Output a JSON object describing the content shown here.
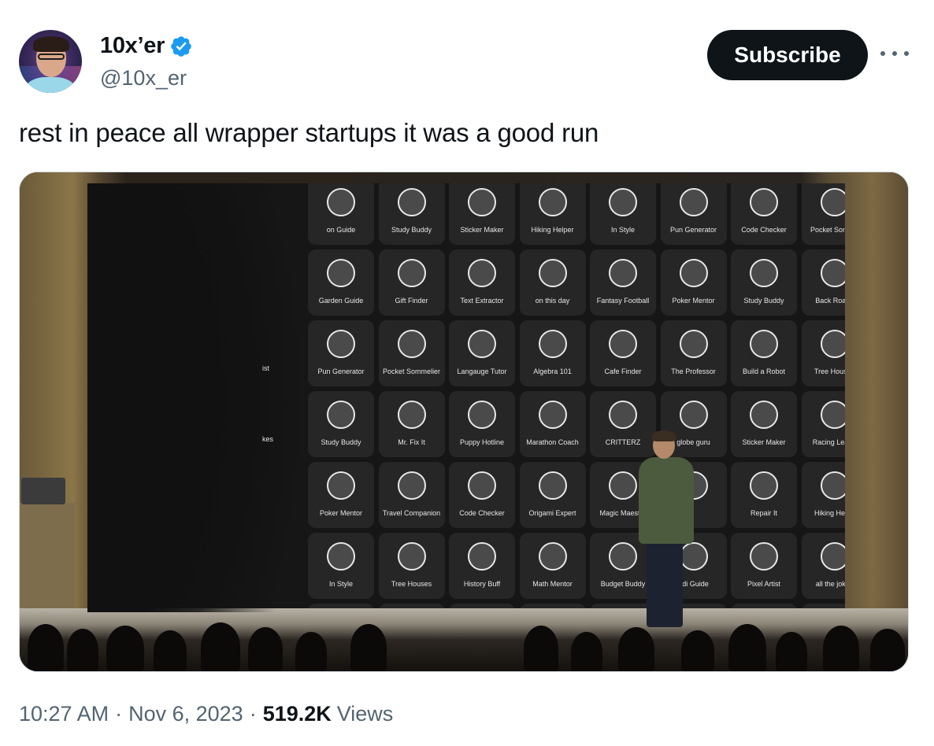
{
  "author": {
    "display_name": "10x’er",
    "handle": "@10x_er",
    "verified": true,
    "verified_icon": "verified-badge-icon",
    "verified_color": "#1d9bf0"
  },
  "actions": {
    "subscribe_label": "Subscribe",
    "more_icon": "more-horizontal-icon"
  },
  "tweet": {
    "text": "rest in peace all wrapper startups it was a good run"
  },
  "media": {
    "app_tiles": [
      [
        "on Guide",
        "Study Buddy",
        "Sticker Maker",
        "Hiking Helper",
        "In Style",
        "Pun Generator",
        "Code Checker",
        "Pocket Somme"
      ],
      [
        "Garden Guide",
        "Gift Finder",
        "Text Extractor",
        "on this day",
        "Fantasy Football",
        "Poker Mentor",
        "Study Buddy",
        "Back Roads"
      ],
      [
        "Pun Generator",
        "Pocket Sommelier",
        "Langauge Tutor",
        "Algebra 101",
        "Cafe Finder",
        "The Professor",
        "Build a Robot",
        "Tree Houses"
      ],
      [
        "Study Buddy",
        "Mr. Fix It",
        "Puppy Hotline",
        "Marathon Coach",
        "CRITTERZ",
        "globe guru",
        "Sticker Maker",
        "Racing Leagu"
      ],
      [
        "Poker Mentor",
        "Travel Companion",
        "Code Checker",
        "Origami Expert",
        "Magic Maestro",
        "",
        "Repair It",
        "Hiking Helpe"
      ],
      [
        "In Style",
        "Tree Houses",
        "History Buff",
        "Math Mentor",
        "Budget Buddy",
        "edi Guide",
        "Pixel Artist",
        "all the jokes"
      ]
    ],
    "left_edge_labels": [
      "ist",
      "kes"
    ]
  },
  "meta": {
    "time": "10:27 AM",
    "separator": "·",
    "date": "Nov 6, 2023",
    "views_count": "519.2K",
    "views_label": "Views"
  }
}
